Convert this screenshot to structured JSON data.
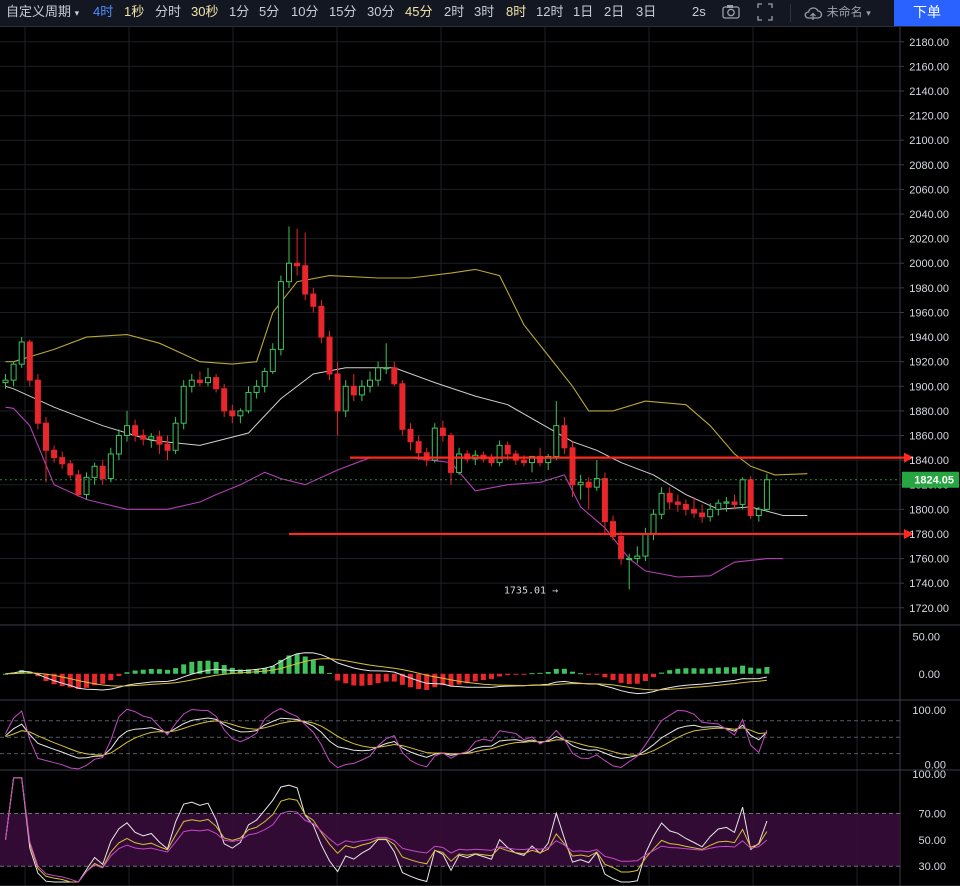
{
  "toolbar": {
    "custom_period": "自定义周期",
    "intervals": [
      {
        "label": "4时",
        "style": "blue"
      },
      {
        "label": "1秒",
        "style": "gold"
      },
      {
        "label": "分时",
        "style": "normal"
      },
      {
        "label": "30秒",
        "style": "gold"
      },
      {
        "label": "1分",
        "style": "normal"
      },
      {
        "label": "5分",
        "style": "normal"
      },
      {
        "label": "10分",
        "style": "normal"
      },
      {
        "label": "15分",
        "style": "normal"
      },
      {
        "label": "30分",
        "style": "normal"
      },
      {
        "label": "45分",
        "style": "gold"
      },
      {
        "label": "2时",
        "style": "normal"
      },
      {
        "label": "3时",
        "style": "normal"
      },
      {
        "label": "8时",
        "style": "gold"
      },
      {
        "label": "12时",
        "style": "normal"
      },
      {
        "label": "1日",
        "style": "normal"
      },
      {
        "label": "2日",
        "style": "normal"
      },
      {
        "label": "3日",
        "style": "normal"
      }
    ],
    "refresh": "2s",
    "icons": [
      "camera-icon",
      "fullscreen-icon",
      "cloud-icon"
    ],
    "layout_name": "未命名",
    "order_button": "下单"
  },
  "colors": {
    "up": "#3ec45b",
    "down": "#e8262b",
    "bb_upper": "#b9a636",
    "bb_mid": "#cfcfcf",
    "bb_lower": "#b43fb4",
    "hline": "#ff2a1f",
    "grid": "#1c1f27"
  },
  "chart_data": {
    "type": "candlestick",
    "price_axis": {
      "ticks": [
        1720,
        1740,
        1760,
        1780,
        1800,
        1820,
        1840,
        1860,
        1880,
        1900,
        1920,
        1940,
        1960,
        1980,
        2000,
        2020,
        2040,
        2060,
        2080,
        2100,
        2120,
        2140,
        2160,
        2180
      ]
    },
    "price_range": [
      1706,
      2192
    ],
    "last_price": "1824.05",
    "last_price_value": 1824.05,
    "low_annotation": {
      "label": "1735.01",
      "value": 1735.01,
      "index": 69
    },
    "horizontal_lines": [
      1842,
      1780
    ],
    "candles": [
      [
        1903,
        1910,
        1898,
        1905
      ],
      [
        1905,
        1920,
        1900,
        1918
      ],
      [
        1918,
        1940,
        1915,
        1936
      ],
      [
        1936,
        1938,
        1900,
        1905
      ],
      [
        1905,
        1910,
        1865,
        1870
      ],
      [
        1870,
        1875,
        1822,
        1848
      ],
      [
        1848,
        1852,
        1838,
        1842
      ],
      [
        1842,
        1847,
        1833,
        1837
      ],
      [
        1837,
        1840,
        1825,
        1828
      ],
      [
        1828,
        1832,
        1810,
        1812
      ],
      [
        1812,
        1830,
        1808,
        1826
      ],
      [
        1826,
        1838,
        1820,
        1835
      ],
      [
        1835,
        1840,
        1820,
        1825
      ],
      [
        1825,
        1850,
        1822,
        1845
      ],
      [
        1845,
        1865,
        1840,
        1860
      ],
      [
        1860,
        1880,
        1855,
        1868
      ],
      [
        1868,
        1873,
        1855,
        1860
      ],
      [
        1860,
        1865,
        1852,
        1857
      ],
      [
        1857,
        1862,
        1850,
        1859
      ],
      [
        1859,
        1864,
        1845,
        1853
      ],
      [
        1853,
        1860,
        1840,
        1848
      ],
      [
        1848,
        1875,
        1845,
        1870
      ],
      [
        1870,
        1905,
        1865,
        1900
      ],
      [
        1900,
        1910,
        1895,
        1905
      ],
      [
        1905,
        1912,
        1900,
        1903
      ],
      [
        1903,
        1915,
        1900,
        1907
      ],
      [
        1907,
        1910,
        1895,
        1898
      ],
      [
        1898,
        1902,
        1875,
        1880
      ],
      [
        1880,
        1885,
        1870,
        1876
      ],
      [
        1876,
        1882,
        1870,
        1880
      ],
      [
        1880,
        1900,
        1878,
        1895
      ],
      [
        1895,
        1905,
        1890,
        1900
      ],
      [
        1900,
        1915,
        1895,
        1912
      ],
      [
        1912,
        1935,
        1910,
        1930
      ],
      [
        1930,
        1990,
        1925,
        1985
      ],
      [
        1985,
        2030,
        1980,
        2000
      ],
      [
        2000,
        2028,
        1990,
        1998
      ],
      [
        1998,
        2025,
        1970,
        1975
      ],
      [
        1975,
        1980,
        1960,
        1965
      ],
      [
        1965,
        1970,
        1935,
        1940
      ],
      [
        1940,
        1945,
        1905,
        1910
      ],
      [
        1910,
        1920,
        1860,
        1880
      ],
      [
        1880,
        1905,
        1875,
        1900
      ],
      [
        1900,
        1910,
        1888,
        1893
      ],
      [
        1893,
        1905,
        1888,
        1900
      ],
      [
        1900,
        1912,
        1895,
        1905
      ],
      [
        1905,
        1920,
        1900,
        1915
      ],
      [
        1915,
        1935,
        1910,
        1915
      ],
      [
        1915,
        1920,
        1900,
        1902
      ],
      [
        1902,
        1905,
        1860,
        1865
      ],
      [
        1865,
        1870,
        1848,
        1855
      ],
      [
        1855,
        1860,
        1840,
        1846
      ],
      [
        1846,
        1850,
        1835,
        1840
      ],
      [
        1840,
        1870,
        1838,
        1866
      ],
      [
        1866,
        1872,
        1855,
        1860
      ],
      [
        1860,
        1862,
        1820,
        1830
      ],
      [
        1830,
        1850,
        1828,
        1845
      ],
      [
        1845,
        1848,
        1838,
        1841
      ],
      [
        1841,
        1848,
        1836,
        1844
      ],
      [
        1844,
        1847,
        1838,
        1841
      ],
      [
        1841,
        1845,
        1835,
        1838
      ],
      [
        1838,
        1856,
        1835,
        1852
      ],
      [
        1852,
        1855,
        1840,
        1845
      ],
      [
        1845,
        1848,
        1836,
        1840
      ],
      [
        1840,
        1844,
        1835,
        1838
      ],
      [
        1838,
        1842,
        1830,
        1843
      ],
      [
        1843,
        1850,
        1835,
        1838
      ],
      [
        1838,
        1845,
        1832,
        1843
      ],
      [
        1843,
        1888,
        1840,
        1868
      ],
      [
        1868,
        1875,
        1845,
        1850
      ],
      [
        1850,
        1855,
        1810,
        1820
      ],
      [
        1820,
        1828,
        1808,
        1822
      ],
      [
        1822,
        1826,
        1800,
        1818
      ],
      [
        1818,
        1840,
        1815,
        1825
      ],
      [
        1825,
        1830,
        1780,
        1790
      ],
      [
        1790,
        1795,
        1775,
        1778
      ],
      [
        1778,
        1782,
        1755,
        1760
      ],
      [
        1760,
        1764,
        1735,
        1760
      ],
      [
        1760,
        1770,
        1756,
        1762
      ],
      [
        1762,
        1785,
        1758,
        1780
      ],
      [
        1780,
        1800,
        1775,
        1796
      ],
      [
        1796,
        1818,
        1792,
        1813
      ],
      [
        1813,
        1818,
        1800,
        1806
      ],
      [
        1806,
        1812,
        1798,
        1804
      ],
      [
        1804,
        1808,
        1795,
        1800
      ],
      [
        1800,
        1810,
        1793,
        1797
      ],
      [
        1797,
        1804,
        1789,
        1794
      ],
      [
        1794,
        1805,
        1790,
        1800
      ],
      [
        1800,
        1808,
        1795,
        1805
      ],
      [
        1805,
        1810,
        1798,
        1806
      ],
      [
        1806,
        1812,
        1800,
        1804
      ],
      [
        1804,
        1826,
        1800,
        1824
      ],
      [
        1824,
        1827,
        1792,
        1795
      ],
      [
        1795,
        1802,
        1790,
        1800
      ],
      [
        1800,
        1829,
        1798,
        1824.05
      ]
    ],
    "bollinger": {
      "upper": [
        [
          0,
          1920
        ],
        [
          1,
          1920
        ],
        [
          6,
          1930
        ],
        [
          10,
          1940
        ],
        [
          15,
          1942
        ],
        [
          19,
          1935
        ],
        [
          24,
          1920
        ],
        [
          28,
          1918
        ],
        [
          31,
          1920
        ],
        [
          33,
          1960
        ],
        [
          36,
          1985
        ],
        [
          40,
          1990
        ],
        [
          46,
          1988
        ],
        [
          50,
          1988
        ],
        [
          55,
          1992
        ],
        [
          58,
          1995
        ],
        [
          61,
          1990
        ],
        [
          64,
          1950
        ],
        [
          67,
          1925
        ],
        [
          70,
          1900
        ],
        [
          72,
          1880
        ],
        [
          75,
          1880
        ],
        [
          79,
          1888
        ],
        [
          84,
          1885
        ],
        [
          87,
          1868
        ],
        [
          90,
          1845
        ],
        [
          92,
          1835
        ],
        [
          95,
          1828
        ],
        [
          99,
          1829
        ]
      ],
      "mid": [
        [
          0,
          1900
        ],
        [
          1,
          1898
        ],
        [
          6,
          1883
        ],
        [
          12,
          1868
        ],
        [
          18,
          1856
        ],
        [
          24,
          1852
        ],
        [
          30,
          1862
        ],
        [
          34,
          1890
        ],
        [
          38,
          1910
        ],
        [
          42,
          1915
        ],
        [
          48,
          1915
        ],
        [
          53,
          1903
        ],
        [
          58,
          1892
        ],
        [
          62,
          1885
        ],
        [
          66,
          1870
        ],
        [
          70,
          1855
        ],
        [
          73,
          1848
        ],
        [
          76,
          1838
        ],
        [
          80,
          1828
        ],
        [
          84,
          1812
        ],
        [
          88,
          1800
        ],
        [
          92,
          1802
        ],
        [
          96,
          1795
        ],
        [
          99,
          1795
        ]
      ],
      "lower": [
        [
          0,
          1883
        ],
        [
          1,
          1882
        ],
        [
          3,
          1868
        ],
        [
          6,
          1820
        ],
        [
          10,
          1808
        ],
        [
          15,
          1800
        ],
        [
          20,
          1800
        ],
        [
          24,
          1806
        ],
        [
          26,
          1812
        ],
        [
          29,
          1820
        ],
        [
          32,
          1830
        ],
        [
          34,
          1825
        ],
        [
          37,
          1820
        ],
        [
          41,
          1832
        ],
        [
          45,
          1842
        ],
        [
          50,
          1842
        ],
        [
          55,
          1838
        ],
        [
          58,
          1815
        ],
        [
          62,
          1820
        ],
        [
          66,
          1822
        ],
        [
          69,
          1828
        ],
        [
          71,
          1802
        ],
        [
          74,
          1785
        ],
        [
          77,
          1760
        ],
        [
          79,
          1750
        ],
        [
          83,
          1745
        ],
        [
          87,
          1746
        ],
        [
          90,
          1757
        ],
        [
          94,
          1760
        ],
        [
          96,
          1760
        ]
      ]
    },
    "macd": {
      "ticks": [
        50,
        0
      ],
      "range": [
        -35,
        65
      ]
    },
    "kdj": {
      "ticks": [
        100,
        0
      ],
      "range": [
        -10,
        118
      ]
    },
    "rsi": {
      "ticks": [
        100,
        70,
        50,
        30
      ],
      "range": [
        15,
        103
      ],
      "band": [
        30,
        70
      ]
    }
  }
}
